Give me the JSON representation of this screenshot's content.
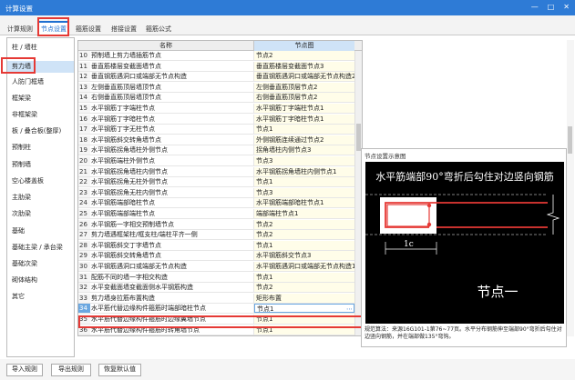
{
  "window": {
    "title": "计算设置",
    "min_glyph": "—",
    "max_glyph": "□",
    "close_glyph": "✕"
  },
  "tabs": [
    {
      "label": "计算规则"
    },
    {
      "label": "节点设置"
    },
    {
      "label": "箍筋设置"
    },
    {
      "label": "搭接设置"
    },
    {
      "label": "箍筋公式"
    }
  ],
  "categories": [
    {
      "label": "柱 / 墙柱"
    },
    {
      "label": "剪力墙"
    },
    {
      "label": "人防门框墙"
    },
    {
      "label": "框架梁"
    },
    {
      "label": "非框架梁"
    },
    {
      "label": "板 / 叠合板(整厚)"
    },
    {
      "label": "预制柱"
    },
    {
      "label": "预制墙"
    },
    {
      "label": "空心楼盖板"
    },
    {
      "label": "主肋梁"
    },
    {
      "label": "次肋梁"
    },
    {
      "label": "基础"
    },
    {
      "label": "基础主梁 / 承台梁"
    },
    {
      "label": "基础次梁"
    },
    {
      "label": "砌体结构"
    },
    {
      "label": "其它"
    }
  ],
  "grid": {
    "col_name": "名称",
    "col_node": "节点图",
    "rows": [
      {
        "num": "10",
        "name": "预制墙上剪力墙插筋节点",
        "value": "节点2"
      },
      {
        "num": "11",
        "name": "垂直筋楼层变截面墙节点",
        "value": "垂直筋楼层变截面节点3"
      },
      {
        "num": "12",
        "name": "垂直钢筋遇洞口或端部无节点构造",
        "value": "垂直钢筋遇洞口或端部无节点构造2"
      },
      {
        "num": "13",
        "name": "左侧垂直筋顶层墙顶节点",
        "value": "左侧垂直筋顶层节点2"
      },
      {
        "num": "14",
        "name": "右侧垂直筋顶层墙顶节点",
        "value": "右侧垂直筋顶层节点2"
      },
      {
        "num": "15",
        "name": "水平钢筋丁字端柱节点",
        "value": "水平钢筋丁字端柱节点1"
      },
      {
        "num": "16",
        "name": "水平钢筋丁字暗柱节点",
        "value": "水平钢筋丁字暗柱节点1"
      },
      {
        "num": "17",
        "name": "水平钢筋丁字无柱节点",
        "value": "节点1"
      },
      {
        "num": "18",
        "name": "水平钢筋斜交转角墙节点",
        "value": "外侧钢筋连续通过节点2"
      },
      {
        "num": "19",
        "name": "水平钢筋拐角墙柱外侧节点",
        "value": "拐角墙柱内侧节点3"
      },
      {
        "num": "20",
        "name": "水平钢筋端柱外侧节点",
        "value": "节点3"
      },
      {
        "num": "21",
        "name": "水平钢筋拐角墙柱内侧节点",
        "value": "水平钢筋拐角墙柱内侧节点1"
      },
      {
        "num": "22",
        "name": "水平钢筋拐角无柱外侧节点",
        "value": "节点1"
      },
      {
        "num": "23",
        "name": "水平钢筋拐角无柱内侧节点",
        "value": "节点3"
      },
      {
        "num": "24",
        "name": "水平钢筋端部暗柱节点",
        "value": "水平钢筋端部暗柱节点1"
      },
      {
        "num": "25",
        "name": "水平钢筋端部端柱节点",
        "value": "端部端柱节点1"
      },
      {
        "num": "26",
        "name": "水平钢筋一字相交预制墙节点",
        "value": "节点2"
      },
      {
        "num": "27",
        "name": "剪力墙遇框架柱/框支柱/端柱平齐一侧",
        "value": "节点2"
      },
      {
        "num": "28",
        "name": "水平钢筋斜交丁字墙节点",
        "value": "节点1"
      },
      {
        "num": "29",
        "name": "水平钢筋斜交转角墙节点",
        "value": "水平钢筋斜交节点3"
      },
      {
        "num": "30",
        "name": "水平钢筋遇洞口或端部无节点构造",
        "value": "水平钢筋遇洞口或端部无节点构造1"
      },
      {
        "num": "31",
        "name": "配筋不同的墙一字相交构造",
        "value": "节点1"
      },
      {
        "num": "32",
        "name": "水平变截面墙变截面侧水平钢筋构造",
        "value": "节点2"
      },
      {
        "num": "33",
        "name": "剪力墙身拉筋布置构造",
        "value": "矩形布置"
      },
      {
        "num": "34",
        "name": "水平筋代替边缘构件箍筋时端部暗柱节点",
        "value": "节点1",
        "selected": true
      },
      {
        "num": "35",
        "name": "水平筋代替边缘构件箍筋时边缘翼墙节点",
        "value": "节点1"
      },
      {
        "num": "36",
        "name": "水平筋代替边缘构件箍筋时转角墙节点",
        "value": "节点1"
      }
    ]
  },
  "preview": {
    "title": "节点设置示意图",
    "diagram_heading": "水平筋端部90°弯折后勾住对边竖向钢筋",
    "dim_label": "1c",
    "node_label": "节点一",
    "note": "规范算法：来源16G101-1第76~77页。水平分布钢筋伸至端部90°弯折后勾住对边竖向钢筋，并在端部做135°弯钩。",
    "colors": {
      "rebar": "#e53935",
      "bg": "#000000",
      "line": "#ffffff"
    }
  },
  "footer": {
    "import_label": "导入规则",
    "export_label": "导出规则",
    "restore_label": "恢复默认值"
  }
}
